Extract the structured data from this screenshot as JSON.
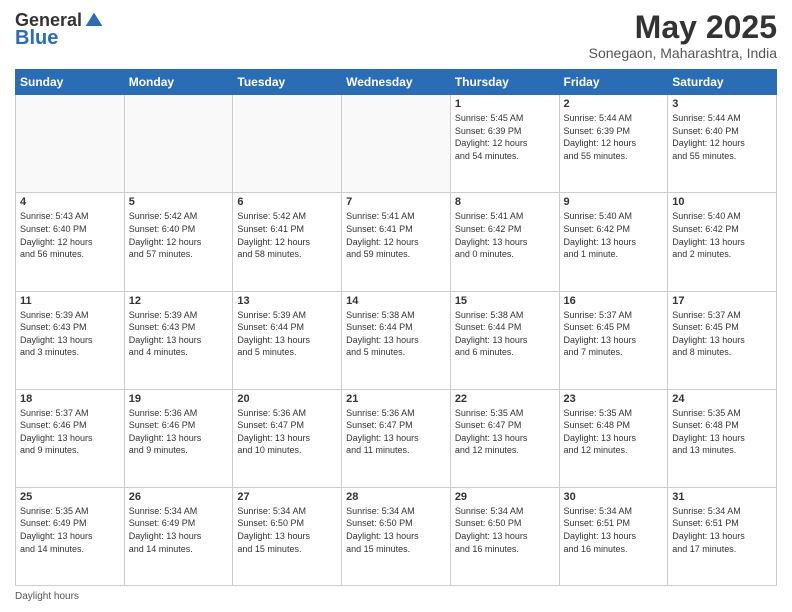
{
  "logo": {
    "general": "General",
    "blue": "Blue"
  },
  "header": {
    "month_year": "May 2025",
    "location": "Sonegaon, Maharashtra, India"
  },
  "days_of_week": [
    "Sunday",
    "Monday",
    "Tuesday",
    "Wednesday",
    "Thursday",
    "Friday",
    "Saturday"
  ],
  "footer": {
    "label": "Daylight hours"
  },
  "weeks": [
    [
      {
        "day": "",
        "info": ""
      },
      {
        "day": "",
        "info": ""
      },
      {
        "day": "",
        "info": ""
      },
      {
        "day": "",
        "info": ""
      },
      {
        "day": "1",
        "info": "Sunrise: 5:45 AM\nSunset: 6:39 PM\nDaylight: 12 hours\nand 54 minutes."
      },
      {
        "day": "2",
        "info": "Sunrise: 5:44 AM\nSunset: 6:39 PM\nDaylight: 12 hours\nand 55 minutes."
      },
      {
        "day": "3",
        "info": "Sunrise: 5:44 AM\nSunset: 6:40 PM\nDaylight: 12 hours\nand 55 minutes."
      }
    ],
    [
      {
        "day": "4",
        "info": "Sunrise: 5:43 AM\nSunset: 6:40 PM\nDaylight: 12 hours\nand 56 minutes."
      },
      {
        "day": "5",
        "info": "Sunrise: 5:42 AM\nSunset: 6:40 PM\nDaylight: 12 hours\nand 57 minutes."
      },
      {
        "day": "6",
        "info": "Sunrise: 5:42 AM\nSunset: 6:41 PM\nDaylight: 12 hours\nand 58 minutes."
      },
      {
        "day": "7",
        "info": "Sunrise: 5:41 AM\nSunset: 6:41 PM\nDaylight: 12 hours\nand 59 minutes."
      },
      {
        "day": "8",
        "info": "Sunrise: 5:41 AM\nSunset: 6:42 PM\nDaylight: 13 hours\nand 0 minutes."
      },
      {
        "day": "9",
        "info": "Sunrise: 5:40 AM\nSunset: 6:42 PM\nDaylight: 13 hours\nand 1 minute."
      },
      {
        "day": "10",
        "info": "Sunrise: 5:40 AM\nSunset: 6:42 PM\nDaylight: 13 hours\nand 2 minutes."
      }
    ],
    [
      {
        "day": "11",
        "info": "Sunrise: 5:39 AM\nSunset: 6:43 PM\nDaylight: 13 hours\nand 3 minutes."
      },
      {
        "day": "12",
        "info": "Sunrise: 5:39 AM\nSunset: 6:43 PM\nDaylight: 13 hours\nand 4 minutes."
      },
      {
        "day": "13",
        "info": "Sunrise: 5:39 AM\nSunset: 6:44 PM\nDaylight: 13 hours\nand 5 minutes."
      },
      {
        "day": "14",
        "info": "Sunrise: 5:38 AM\nSunset: 6:44 PM\nDaylight: 13 hours\nand 5 minutes."
      },
      {
        "day": "15",
        "info": "Sunrise: 5:38 AM\nSunset: 6:44 PM\nDaylight: 13 hours\nand 6 minutes."
      },
      {
        "day": "16",
        "info": "Sunrise: 5:37 AM\nSunset: 6:45 PM\nDaylight: 13 hours\nand 7 minutes."
      },
      {
        "day": "17",
        "info": "Sunrise: 5:37 AM\nSunset: 6:45 PM\nDaylight: 13 hours\nand 8 minutes."
      }
    ],
    [
      {
        "day": "18",
        "info": "Sunrise: 5:37 AM\nSunset: 6:46 PM\nDaylight: 13 hours\nand 9 minutes."
      },
      {
        "day": "19",
        "info": "Sunrise: 5:36 AM\nSunset: 6:46 PM\nDaylight: 13 hours\nand 9 minutes."
      },
      {
        "day": "20",
        "info": "Sunrise: 5:36 AM\nSunset: 6:47 PM\nDaylight: 13 hours\nand 10 minutes."
      },
      {
        "day": "21",
        "info": "Sunrise: 5:36 AM\nSunset: 6:47 PM\nDaylight: 13 hours\nand 11 minutes."
      },
      {
        "day": "22",
        "info": "Sunrise: 5:35 AM\nSunset: 6:47 PM\nDaylight: 13 hours\nand 12 minutes."
      },
      {
        "day": "23",
        "info": "Sunrise: 5:35 AM\nSunset: 6:48 PM\nDaylight: 13 hours\nand 12 minutes."
      },
      {
        "day": "24",
        "info": "Sunrise: 5:35 AM\nSunset: 6:48 PM\nDaylight: 13 hours\nand 13 minutes."
      }
    ],
    [
      {
        "day": "25",
        "info": "Sunrise: 5:35 AM\nSunset: 6:49 PM\nDaylight: 13 hours\nand 14 minutes."
      },
      {
        "day": "26",
        "info": "Sunrise: 5:34 AM\nSunset: 6:49 PM\nDaylight: 13 hours\nand 14 minutes."
      },
      {
        "day": "27",
        "info": "Sunrise: 5:34 AM\nSunset: 6:50 PM\nDaylight: 13 hours\nand 15 minutes."
      },
      {
        "day": "28",
        "info": "Sunrise: 5:34 AM\nSunset: 6:50 PM\nDaylight: 13 hours\nand 15 minutes."
      },
      {
        "day": "29",
        "info": "Sunrise: 5:34 AM\nSunset: 6:50 PM\nDaylight: 13 hours\nand 16 minutes."
      },
      {
        "day": "30",
        "info": "Sunrise: 5:34 AM\nSunset: 6:51 PM\nDaylight: 13 hours\nand 16 minutes."
      },
      {
        "day": "31",
        "info": "Sunrise: 5:34 AM\nSunset: 6:51 PM\nDaylight: 13 hours\nand 17 minutes."
      }
    ]
  ]
}
